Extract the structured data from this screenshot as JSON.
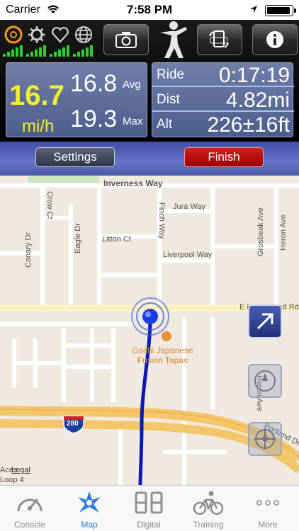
{
  "status": {
    "carrier": "Carrier",
    "time": "7:58 PM"
  },
  "console": {
    "speed": "16.7",
    "speed_unit": "mi/h",
    "avg_value": "16.8",
    "avg_label": "Avg",
    "max_value": "19.3",
    "max_label": "Max",
    "stats": [
      {
        "label": "Ride",
        "value": "0:17:19"
      },
      {
        "label": "Dist",
        "value": "4.82mi"
      },
      {
        "label": "Alt",
        "value": "226±16ft"
      }
    ],
    "settings_label": "Settings",
    "finish_label": "Finish"
  },
  "map": {
    "streets": {
      "inverness": "Inverness Way",
      "crow": "Crow Ct",
      "jura": "Jura Way",
      "finch": "Finch Way",
      "grosbeak": "Grosbeak Ave",
      "heron_top": "Heron Ave",
      "eagle": "Eagle Dr",
      "canary": "Canary Dr",
      "litton": "Litton Ct",
      "liverpool": "Liverpool Way",
      "homestead": "E Homestead Rd",
      "heron_bottom": "Heron Ave",
      "portland": "Portland Dr",
      "loop": "Loop 4",
      "ace": "Aces"
    },
    "poi_line1": "Gochi Japanese",
    "poi_line2": "Fusion Tapas",
    "highway_shield": "280",
    "legal": "Legal"
  },
  "tabs": [
    {
      "label": "Console",
      "icon": "speedometer-icon"
    },
    {
      "label": "Map",
      "icon": "map-compass-icon"
    },
    {
      "label": "Digital",
      "icon": "digital-display-icon"
    },
    {
      "label": "Training",
      "icon": "cyclist-icon"
    },
    {
      "label": "More",
      "icon": "more-dots-icon"
    }
  ],
  "colors": {
    "speed": "#f2ee2b",
    "finish": "#c20d0d",
    "route": "#0a1ab8",
    "tab_active": "#2b7de0",
    "signal": "#2bd12b"
  }
}
